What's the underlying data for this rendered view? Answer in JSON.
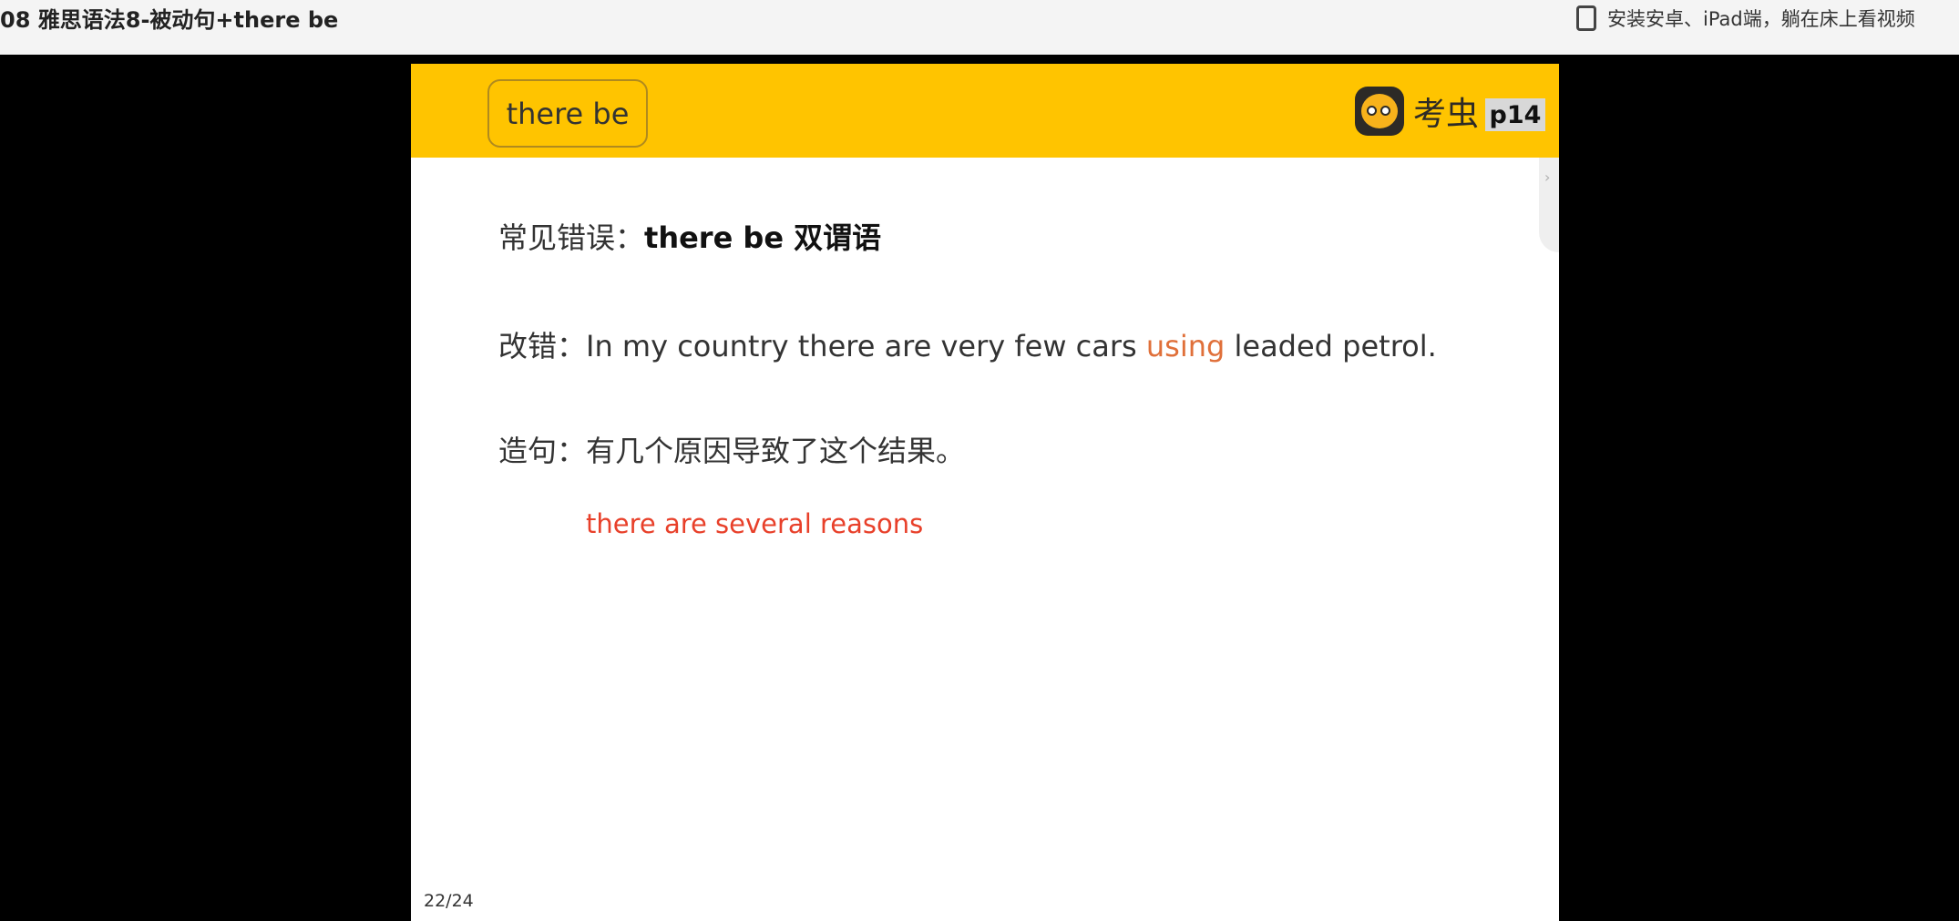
{
  "page": {
    "title": "08 雅思语法8-被动句+there be",
    "install_text": "安装安卓、iPad端，躺在床上看视频"
  },
  "slide": {
    "topic": "there be",
    "brand": "考虫",
    "page_tag": "p14",
    "mistake_label": "常见错误：",
    "mistake_text": "there be 双谓语",
    "correction_label": "改错：",
    "correction_pre": "In my country there are very few cars ",
    "correction_highlight": "using",
    "correction_post": " leaded petrol.",
    "sentence_label": "造句：",
    "sentence_text": "有几个原因导致了这个结果。",
    "answer": "there are several reasons",
    "counter": "22/24"
  },
  "icons": {
    "install": "tablet-icon",
    "brand": "koochong-logo-icon",
    "side": "chevron-right-icon"
  }
}
